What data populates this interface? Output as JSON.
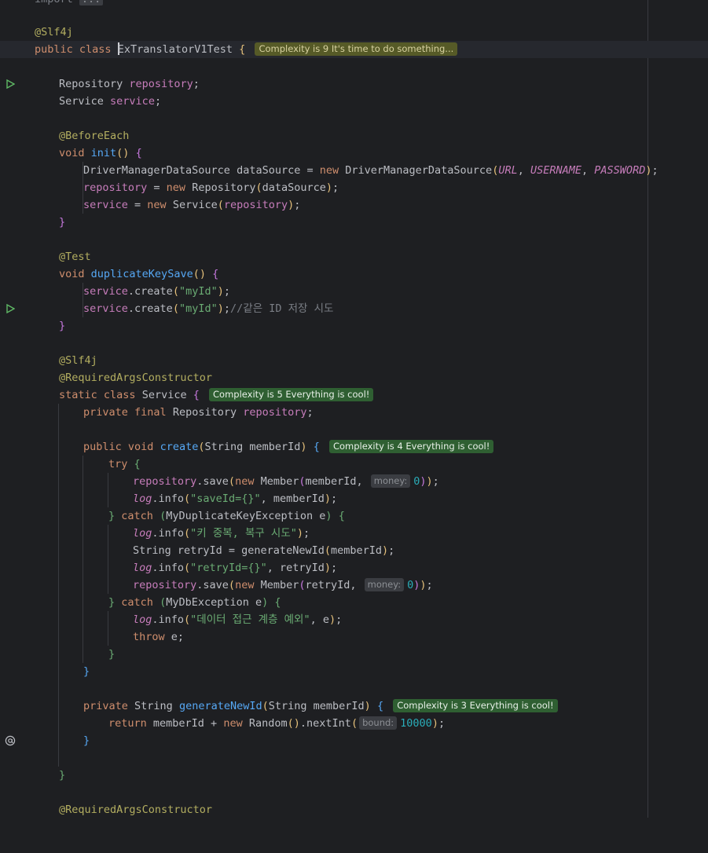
{
  "import_fold": {
    "keyword": "import",
    "ellipsis": "..."
  },
  "class_decl": {
    "annotation": "@Slf4j",
    "kw_public": "public",
    "kw_class": "class",
    "name": "ExTranslatorV1Test",
    "brace": "{",
    "complexity_badge": "Complexity is 9 It's time to do something..."
  },
  "fields": {
    "repo_type": "Repository",
    "repo_name": "repository",
    "semi1": ";",
    "svc_type": "Service",
    "svc_name": "service",
    "semi2": ";"
  },
  "init": {
    "annotation": "@BeforeEach",
    "kw_void": "void",
    "name": "init",
    "parens": "()",
    "brace": "{",
    "l1_type": "DriverManagerDataSource dataSource = ",
    "l1_new": "new",
    "l1_ctor": " DriverManagerDataSource",
    "l1_open": "(",
    "l1_url": "URL",
    "l1_sep1": ", ",
    "l1_user": "USERNAME",
    "l1_sep2": ", ",
    "l1_pass": "PASSWORD",
    "l1_close": ")",
    "l1_semi": ";",
    "l2_field": "repository",
    "l2_eq": " = ",
    "l2_new": "new",
    "l2_ctor": " Repository",
    "l2_open": "(",
    "l2_arg": "dataSource",
    "l2_close": ")",
    "l2_semi": ";",
    "l3_field": "service",
    "l3_eq": " = ",
    "l3_new": "new",
    "l3_ctor": " Service",
    "l3_open": "(",
    "l3_arg": "repository",
    "l3_close": ")",
    "l3_semi": ";",
    "close": "}"
  },
  "test": {
    "annotation": "@Test",
    "kw_void": "void",
    "name": "duplicateKeySave",
    "parens": "()",
    "brace": "{",
    "c1_field": "service",
    "c1_call": ".create",
    "c1_open": "(",
    "c1_arg": "\"myId\"",
    "c1_close": ")",
    "c1_semi": ";",
    "c2_field": "service",
    "c2_call": ".create",
    "c2_open": "(",
    "c2_arg": "\"myId\"",
    "c2_close": ")",
    "c2_semi": ";",
    "comment": "//같은 ID 저장 시도",
    "close": "}"
  },
  "service_class": {
    "ann1": "@Slf4j",
    "ann2": "@RequiredArgsConstructor",
    "kw_static": "static",
    "kw_class": "class",
    "name": " Service ",
    "brace": "{",
    "complexity_badge": "Complexity is 5 Everything is cool!",
    "f_private": "private",
    "f_final": "final",
    "f_type": " Repository ",
    "f_name": "repository",
    "f_semi": ";",
    "create": {
      "kw_public": "public",
      "kw_void": "void",
      "name": "create",
      "open": "(",
      "params": "String memberId",
      "close": ")",
      "brace": "{",
      "complexity_badge": "Complexity is 4 Everything is cool!",
      "kw_try": "try",
      "try_brace": "{",
      "s1_field": "repository",
      "s1_call": ".save",
      "s1_open": "(",
      "s1_new": "new",
      "s1_ctor": " Member",
      "s1_open2": "(",
      "s1_arg": "memberId, ",
      "s1_hint": "money:",
      "s1_num": "0",
      "s1_close2": ")",
      "s1_close": ")",
      "s1_semi": ";",
      "s2_log": "log",
      "s2_call": ".info",
      "s2_open": "(",
      "s2_str": "\"saveId={}\"",
      "s2_rest": ", memberId",
      "s2_close": ")",
      "s2_semi": ";",
      "catch1_close": "}",
      "kw_catch1": "catch",
      "catch1_open": "(",
      "catch1_param": "MyDuplicateKeyException e",
      "catch1_close2": ")",
      "catch1_brace": "{",
      "s3_log": "log",
      "s3_call": ".info",
      "s3_open": "(",
      "s3_str": "\"키 중복, 복구 시도\"",
      "s3_close": ")",
      "s3_semi": ";",
      "s4_decl": "String retryId = generateNewId",
      "s4_open": "(",
      "s4_arg": "memberId",
      "s4_close": ")",
      "s4_semi": ";",
      "s5_log": "log",
      "s5_call": ".info",
      "s5_open": "(",
      "s5_str": "\"retryId={}\"",
      "s5_rest": ", retryId",
      "s5_close": ")",
      "s5_semi": ";",
      "s6_field": "repository",
      "s6_call": ".save",
      "s6_open": "(",
      "s6_new": "new",
      "s6_ctor": " Member",
      "s6_open2": "(",
      "s6_arg": "retryId, ",
      "s6_hint": "money:",
      "s6_num": "0",
      "s6_close2": ")",
      "s6_close": ")",
      "s6_semi": ";",
      "catch2_close": "}",
      "kw_catch2": "catch",
      "catch2_open": "(",
      "catch2_param": "MyDbException e",
      "catch2_close2": ")",
      "catch2_brace": "{",
      "s7_log": "log",
      "s7_call": ".info",
      "s7_open": "(",
      "s7_str": "\"데이터 접근 계층 예외\"",
      "s7_rest": ", e",
      "s7_close": ")",
      "s7_semi": ";",
      "kw_throw": "throw",
      "throw_rest": " e;",
      "try_end": "}",
      "method_end": "}"
    },
    "gen": {
      "kw_private": "private",
      "type": " String ",
      "name": "generateNewId",
      "open": "(",
      "params": "String memberId",
      "close": ")",
      "brace": "{",
      "complexity_badge": "Complexity is 3 Everything is cool!",
      "kw_return": "return",
      "expr1": " memberId + ",
      "kw_new": "new",
      "ctor": " Random",
      "open2": "(",
      "close2": ")",
      "call": ".nextInt",
      "open3": "(",
      "hint": "bound:",
      "num": "10000",
      "close3": ")",
      "semi": ";",
      "end": "}"
    },
    "class_end": "}"
  },
  "trailing_annotation": "@RequiredArgsConstructor",
  "gutter_icons": {
    "run_class": "run-icon",
    "run_test": "run-icon",
    "override": "at-sign-icon"
  }
}
